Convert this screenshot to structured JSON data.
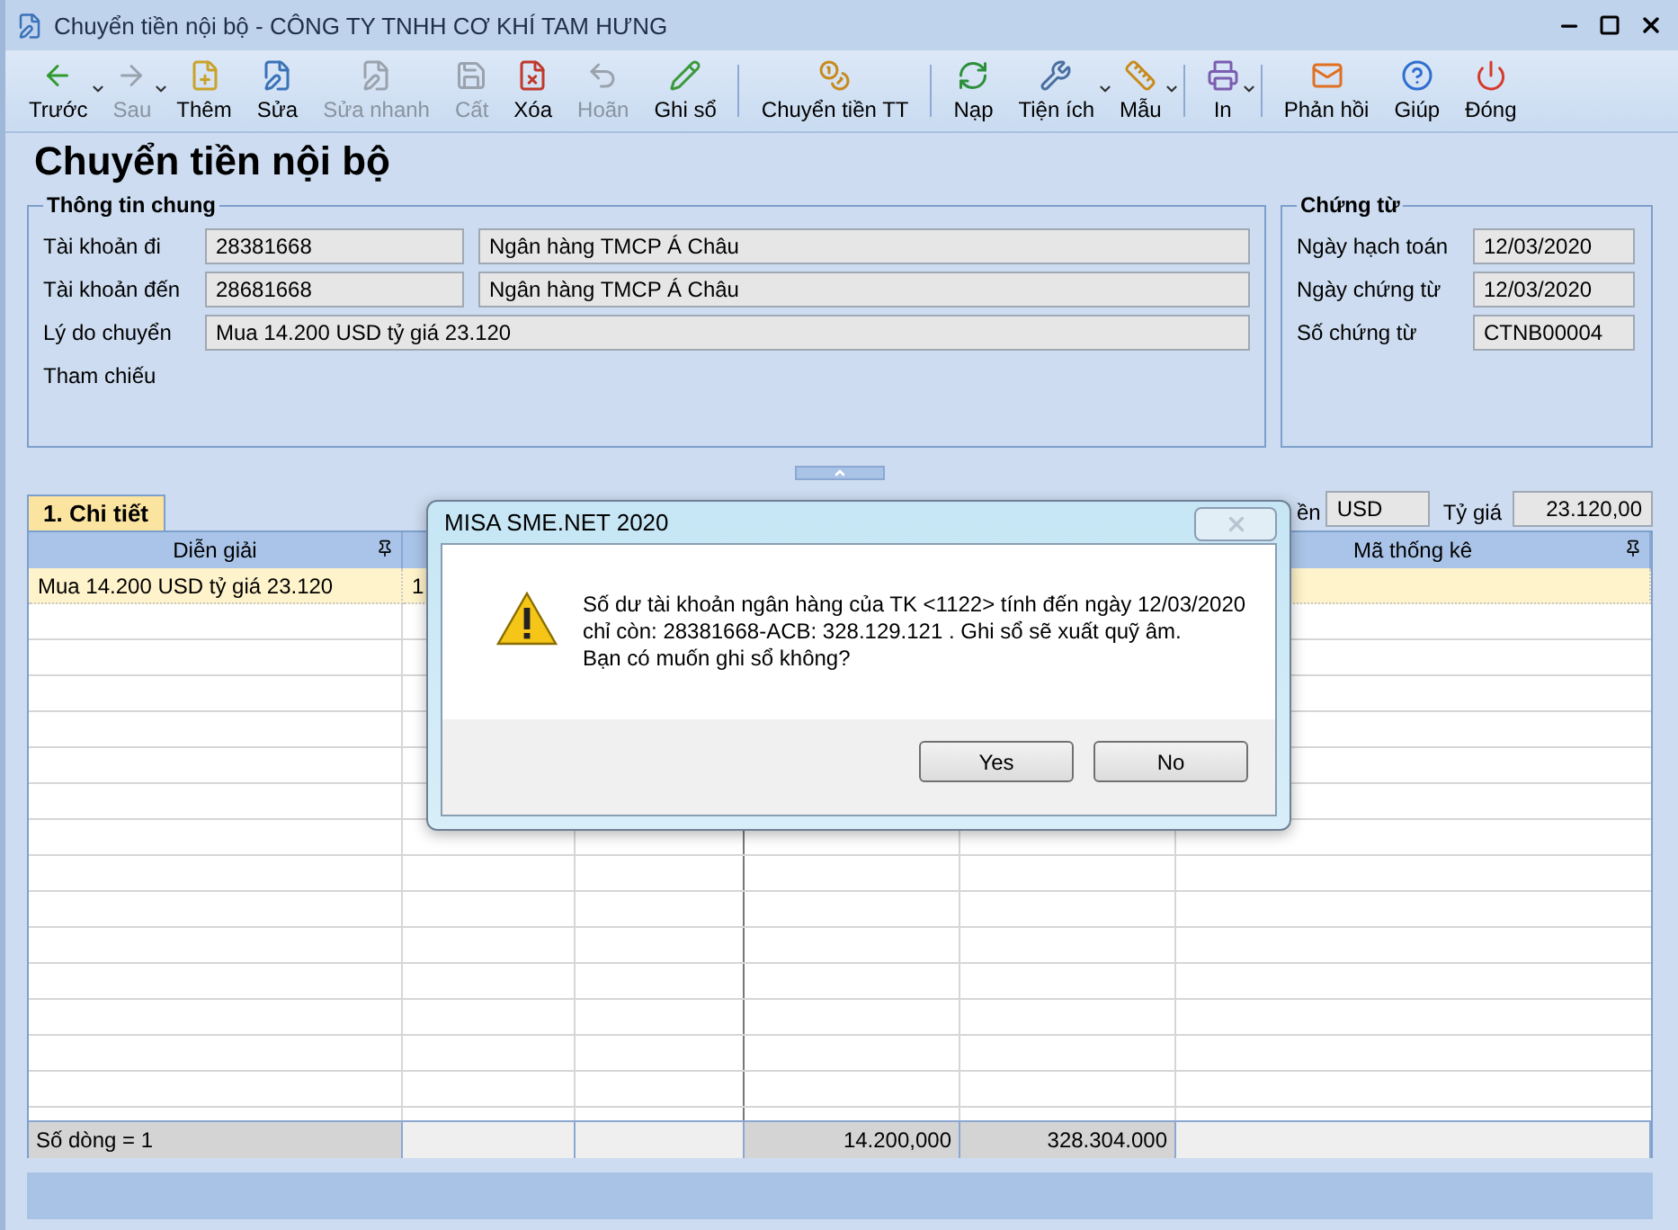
{
  "window": {
    "title": "Chuyển tiền nội bộ - CÔNG TY TNHH CƠ KHÍ TAM HƯNG"
  },
  "toolbar": [
    {
      "label": "Trước",
      "disabled": false,
      "dropdown": true,
      "separator_before": false
    },
    {
      "label": "Sau",
      "disabled": true,
      "dropdown": true,
      "separator_before": false
    },
    {
      "label": "Thêm",
      "disabled": false,
      "dropdown": false,
      "separator_before": false
    },
    {
      "label": "Sửa",
      "disabled": false,
      "dropdown": false,
      "separator_before": false
    },
    {
      "label": "Sửa nhanh",
      "disabled": true,
      "dropdown": false,
      "separator_before": false
    },
    {
      "label": "Cất",
      "disabled": true,
      "dropdown": false,
      "separator_before": false
    },
    {
      "label": "Xóa",
      "disabled": false,
      "dropdown": false,
      "separator_before": false
    },
    {
      "label": "Hoãn",
      "disabled": true,
      "dropdown": false,
      "separator_before": false
    },
    {
      "label": "Ghi sổ",
      "disabled": false,
      "dropdown": false,
      "separator_before": false
    },
    {
      "label": "Chuyển tiền TT",
      "disabled": false,
      "dropdown": false,
      "separator_before": true
    },
    {
      "label": "Nạp",
      "disabled": false,
      "dropdown": false,
      "separator_before": true
    },
    {
      "label": "Tiện ích",
      "disabled": false,
      "dropdown": true,
      "separator_before": false
    },
    {
      "label": "Mẫu",
      "disabled": false,
      "dropdown": true,
      "separator_before": false
    },
    {
      "label": "In",
      "disabled": false,
      "dropdown": true,
      "separator_before": true
    },
    {
      "label": "Phản hồi",
      "disabled": false,
      "dropdown": false,
      "separator_before": true
    },
    {
      "label": "Giúp",
      "disabled": false,
      "dropdown": false,
      "separator_before": false
    },
    {
      "label": "Đóng",
      "disabled": false,
      "dropdown": false,
      "separator_before": false
    }
  ],
  "page_title": "Chuyển tiền nội bộ",
  "general": {
    "title": "Thông tin chung",
    "rows": [
      {
        "label": "Tài khoản đi",
        "account": "28381668",
        "bank": "Ngân hàng TMCP Á Châu"
      },
      {
        "label": "Tài khoản đến",
        "account": "28681668",
        "bank": "Ngân hàng TMCP Á Châu"
      },
      {
        "label": "Lý do chuyển",
        "value": "Mua 14.200 USD tỷ giá 23.120"
      },
      {
        "label": "Tham chiếu"
      }
    ]
  },
  "voucher": {
    "title": "Chứng từ",
    "rows": [
      {
        "label": "Ngày hạch toán",
        "value": "12/03/2020"
      },
      {
        "label": "Ngày chứng từ",
        "value": "12/03/2020"
      },
      {
        "label": "Số chứng từ",
        "value": "CTNB00004"
      }
    ]
  },
  "tabs": [
    {
      "label": "1. Chi tiết",
      "selected": true
    }
  ],
  "currency": {
    "label": "ền",
    "value": "USD",
    "rate_label": "Tỷ giá",
    "rate": "23.120,00"
  },
  "table": {
    "columns": [
      {
        "label": "Diễn giải",
        "pinned": true
      },
      {
        "label": "Mã thống kê",
        "pinned": true
      }
    ],
    "rows": [
      {
        "description": "Mua 14.200 USD tỷ giá 23.120",
        "column_2": "1",
        "selected": true
      }
    ],
    "footer": {
      "label": "Số dòng = 1",
      "column_4": "14.200,000",
      "column_5": "328.304.000"
    }
  },
  "dialog": {
    "title": "MISA SME.NET 2020",
    "close_disabled": true,
    "message": [
      "Số dư tài khoản ngân hàng của TK <1122> tính đến ngày 12/03/2020",
      "chỉ còn: 28381668-ACB: 328.129.121 . Ghi sổ sẽ xuất quỹ âm.",
      "Bạn có muốn ghi sổ không?"
    ],
    "buttons": [
      "Yes",
      "No"
    ]
  }
}
